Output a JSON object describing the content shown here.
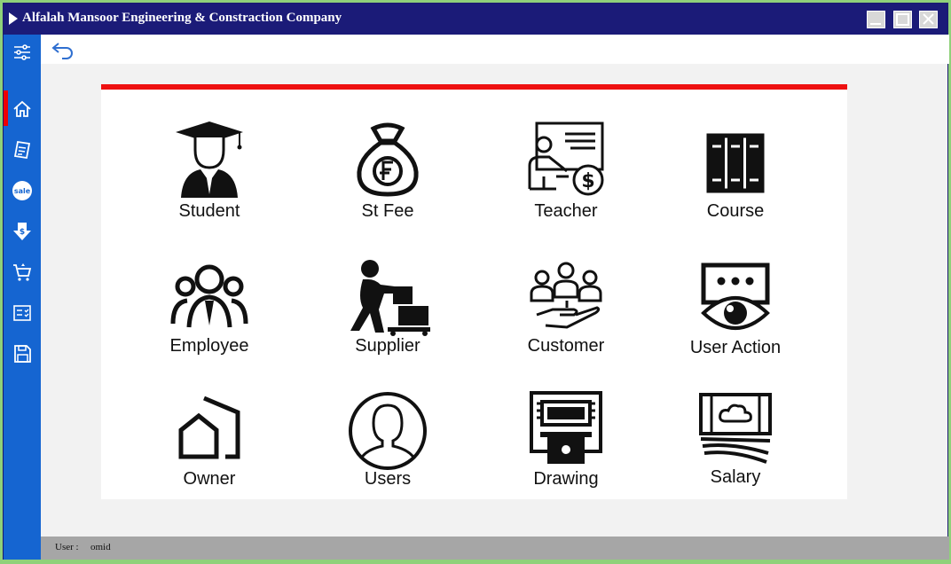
{
  "window": {
    "title": "Alfalah Mansoor Engineering & Constraction Company"
  },
  "sidebar": {
    "items": [
      {
        "icon": "settings-sliders-icon"
      },
      {
        "icon": "home-icon"
      },
      {
        "icon": "receipt-icon"
      },
      {
        "icon": "sale-badge-icon"
      },
      {
        "icon": "download-dollar-icon"
      },
      {
        "icon": "cart-return-icon"
      },
      {
        "icon": "checklist-icon"
      },
      {
        "icon": "save-icon"
      }
    ]
  },
  "tiles": [
    {
      "label": "Student",
      "icon": "graduate-icon"
    },
    {
      "label": "St Fee",
      "icon": "money-bag-icon"
    },
    {
      "label": "Teacher",
      "icon": "teacher-board-icon"
    },
    {
      "label": "Course",
      "icon": "books-icon"
    },
    {
      "label": "Employee",
      "icon": "team-icon"
    },
    {
      "label": "Supplier",
      "icon": "delivery-cart-icon"
    },
    {
      "label": "Customer",
      "icon": "customers-hand-icon"
    },
    {
      "label": "User Action",
      "icon": "eye-monitor-icon"
    },
    {
      "label": "Owner",
      "icon": "houses-icon"
    },
    {
      "label": "Users",
      "icon": "user-circle-icon"
    },
    {
      "label": "Drawing",
      "icon": "atm-icon"
    },
    {
      "label": "Salary",
      "icon": "cash-icon"
    }
  ],
  "status": {
    "user_label": "User :",
    "user_value": "omid"
  },
  "colors": {
    "titlebar": "#1b1b78",
    "sidebar": "#1565d1",
    "accent_bar": "#ee1111",
    "statusbar": "#a6a6a6"
  }
}
